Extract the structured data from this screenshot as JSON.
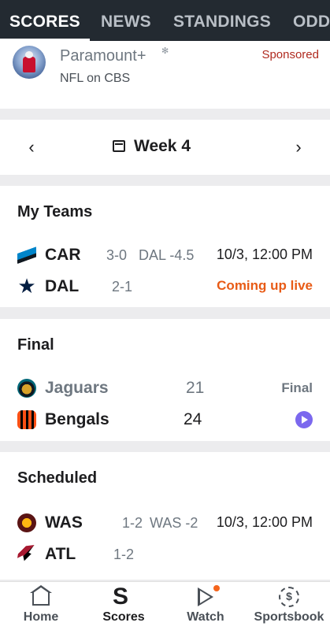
{
  "top_tabs": [
    {
      "label": "SCORES",
      "active": true
    },
    {
      "label": "NEWS",
      "active": false
    },
    {
      "label": "STANDINGS",
      "active": false
    },
    {
      "label": "ODD",
      "active": false
    }
  ],
  "sponsor": {
    "brand": "Paramount+",
    "subtitle": "NFL on CBS",
    "tag": "Sponsored"
  },
  "week": {
    "title": "Week 4"
  },
  "sections": {
    "my_teams": {
      "heading": "My Teams",
      "teams": [
        {
          "abbr": "CAR",
          "record": "3-0",
          "spread": "DAL -4.5",
          "time": "10/3, 12:00 PM"
        },
        {
          "abbr": "DAL",
          "record": "2-1",
          "status": "Coming up live"
        }
      ]
    },
    "final": {
      "heading": "Final",
      "teams": [
        {
          "name": "Jaguars",
          "score": "21",
          "status": "Final"
        },
        {
          "name": "Bengals",
          "score": "24"
        }
      ]
    },
    "scheduled": {
      "heading": "Scheduled",
      "teams": [
        {
          "abbr": "WAS",
          "record": "1-2",
          "spread": "WAS -2",
          "time": "10/3, 12:00 PM"
        },
        {
          "abbr": "ATL",
          "record": "1-2"
        }
      ]
    }
  },
  "bottom_nav": [
    {
      "label": "Home",
      "icon": "home-icon"
    },
    {
      "label": "Scores",
      "icon": "scores-icon",
      "active": true
    },
    {
      "label": "Watch",
      "icon": "watch-icon",
      "badge_dot": true
    },
    {
      "label": "Sportsbook",
      "icon": "sportsbook-icon"
    }
  ],
  "colors": {
    "topbar_bg": "#232a31",
    "live_orange": "#e85b16",
    "sponsored_red": "#b02a1f",
    "play_purple": "#7b68ee"
  }
}
